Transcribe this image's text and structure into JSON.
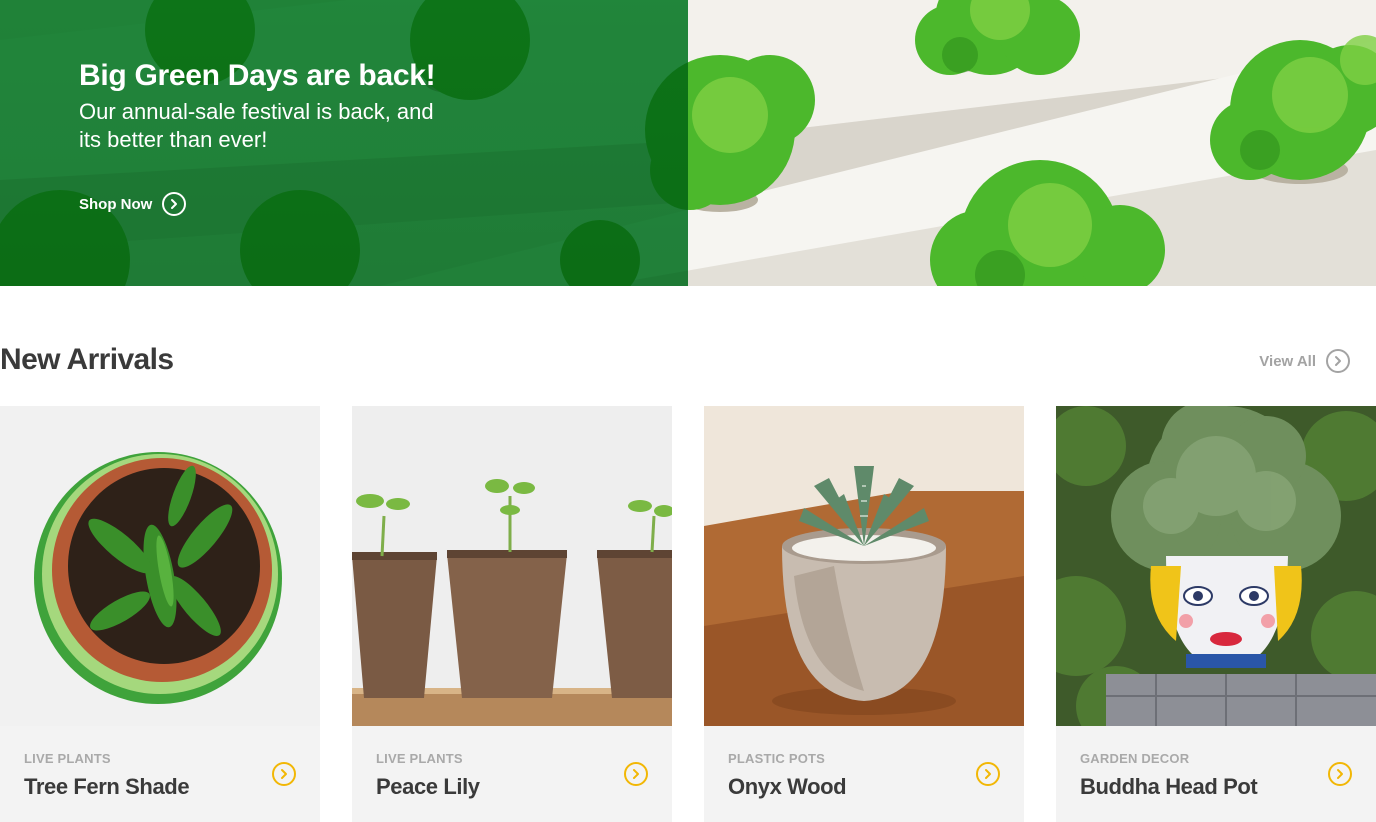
{
  "hero": {
    "title": "Big Green Days are back!",
    "subtitle": "Our annual-sale festival is back, and its better than ever!",
    "cta_label": "Shop Now",
    "accent": "#17a04a"
  },
  "new_arrivals": {
    "title": "New Arrivals",
    "view_all_label": "View All"
  },
  "products": [
    {
      "category": "LIVE PLANTS",
      "name": "Tree Fern Shade",
      "image": "potted-pepper-plant-top-view"
    },
    {
      "category": "LIVE PLANTS",
      "name": "Peace Lily",
      "image": "seedlings-in-peat-pots"
    },
    {
      "category": "PLASTIC POTS",
      "name": "Onyx Wood",
      "image": "succulent-in-round-pot"
    },
    {
      "category": "GARDEN DECOR",
      "name": "Buddha Head Pot",
      "image": "head-planter-with-shrub"
    }
  ],
  "colors": {
    "go_icon": "#f2b705",
    "card_bg": "#f3f3f3",
    "muted_text": "#a9a9a9",
    "heading_text": "#3a3a3a"
  }
}
